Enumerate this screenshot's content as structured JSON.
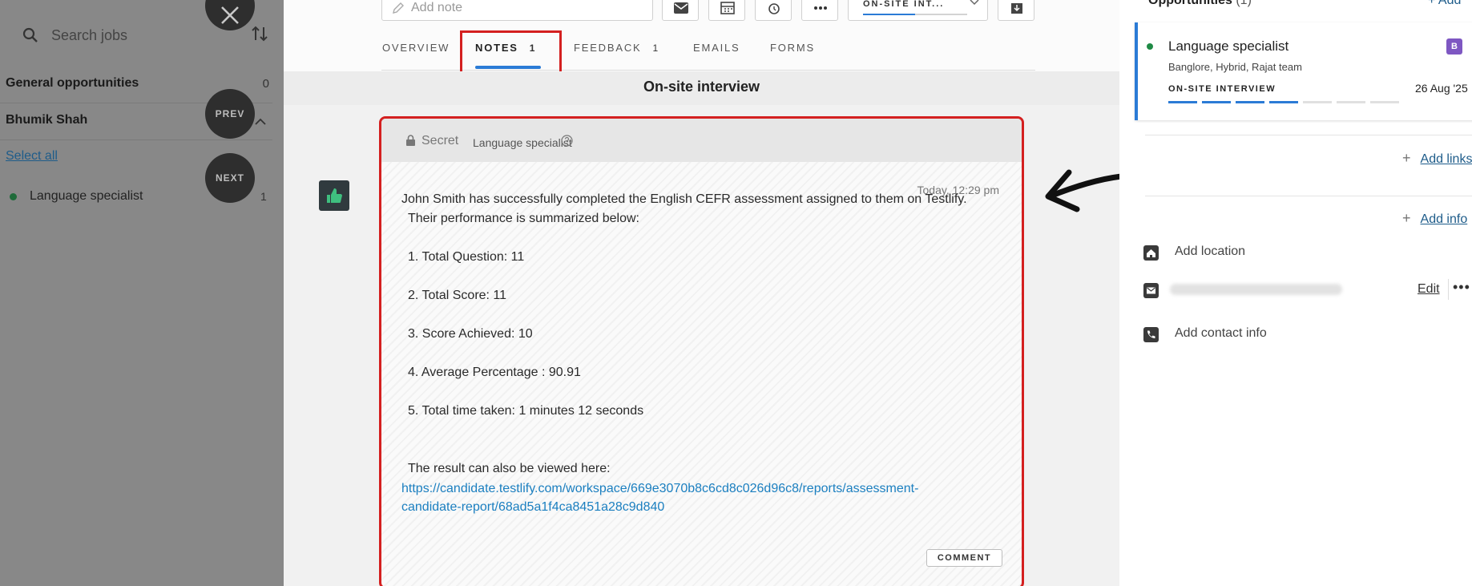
{
  "left_panel": {
    "search_placeholder": "Search jobs",
    "general_opportunities": {
      "label": "General opportunities",
      "count": "0"
    },
    "candidate_group": {
      "label": "Bhumik Shah"
    },
    "select_all": "Select all",
    "jobs": [
      {
        "label": "Language specialist",
        "count": "1"
      }
    ],
    "prev_label": "PREV",
    "next_label": "NEXT"
  },
  "toolbar": {
    "add_note_placeholder": "Add note",
    "stage_label": "ON-SITE INT..."
  },
  "tabs": [
    {
      "label": "OVERVIEW",
      "count": ""
    },
    {
      "label": "NOTES",
      "count": "1"
    },
    {
      "label": "FEEDBACK",
      "count": "1"
    },
    {
      "label": "EMAILS",
      "count": ""
    },
    {
      "label": "FORMS",
      "count": ""
    }
  ],
  "stage_header": "On-site interview",
  "note": {
    "visibility": "Secret",
    "job": "Language specialist",
    "timestamp": "Today, 12:29 pm",
    "lines": [
      "John Smith has successfully completed the English CEFR assessment assigned to them on Testlify.",
      "Their performance is summarized below:",
      "1. Total Question: 11",
      "2. Total Score: 11",
      "3. Score Achieved: 10",
      "4. Average Percentage : 90.91",
      "5. Total time taken: 1 minutes 12 seconds",
      "The result can also be viewed here:"
    ],
    "link_line1": "https://candidate.testlify.com/workspace/669e3070b8c6cd8c026d96c8/reports/assessment-",
    "link_line2": "candidate-report/68ad5a1f4ca8451a28c9d840",
    "comment_label": "COMMENT"
  },
  "right_panel": {
    "opportunities_title": "Opportunities",
    "opportunities_count": "(1)",
    "opportunities_add": "+ Add",
    "opportunity": {
      "name": "Language specialist",
      "details": "Banglore, Hybrid, Rajat team",
      "stage": "ON-SITE INTERVIEW",
      "date": "26 Aug '25",
      "badge": "B",
      "progress_filled": 4,
      "progress_total": 7
    },
    "add_links": "Add links",
    "add_info": "Add info",
    "add_location": "Add location",
    "email_edit": "Edit",
    "email_more": "•••",
    "add_contact_info": "Add contact info"
  },
  "colors": {
    "accent": "#2b7bd6",
    "highlight": "#d42020",
    "link": "#1b7fc0",
    "badge": "#7e57c2"
  }
}
